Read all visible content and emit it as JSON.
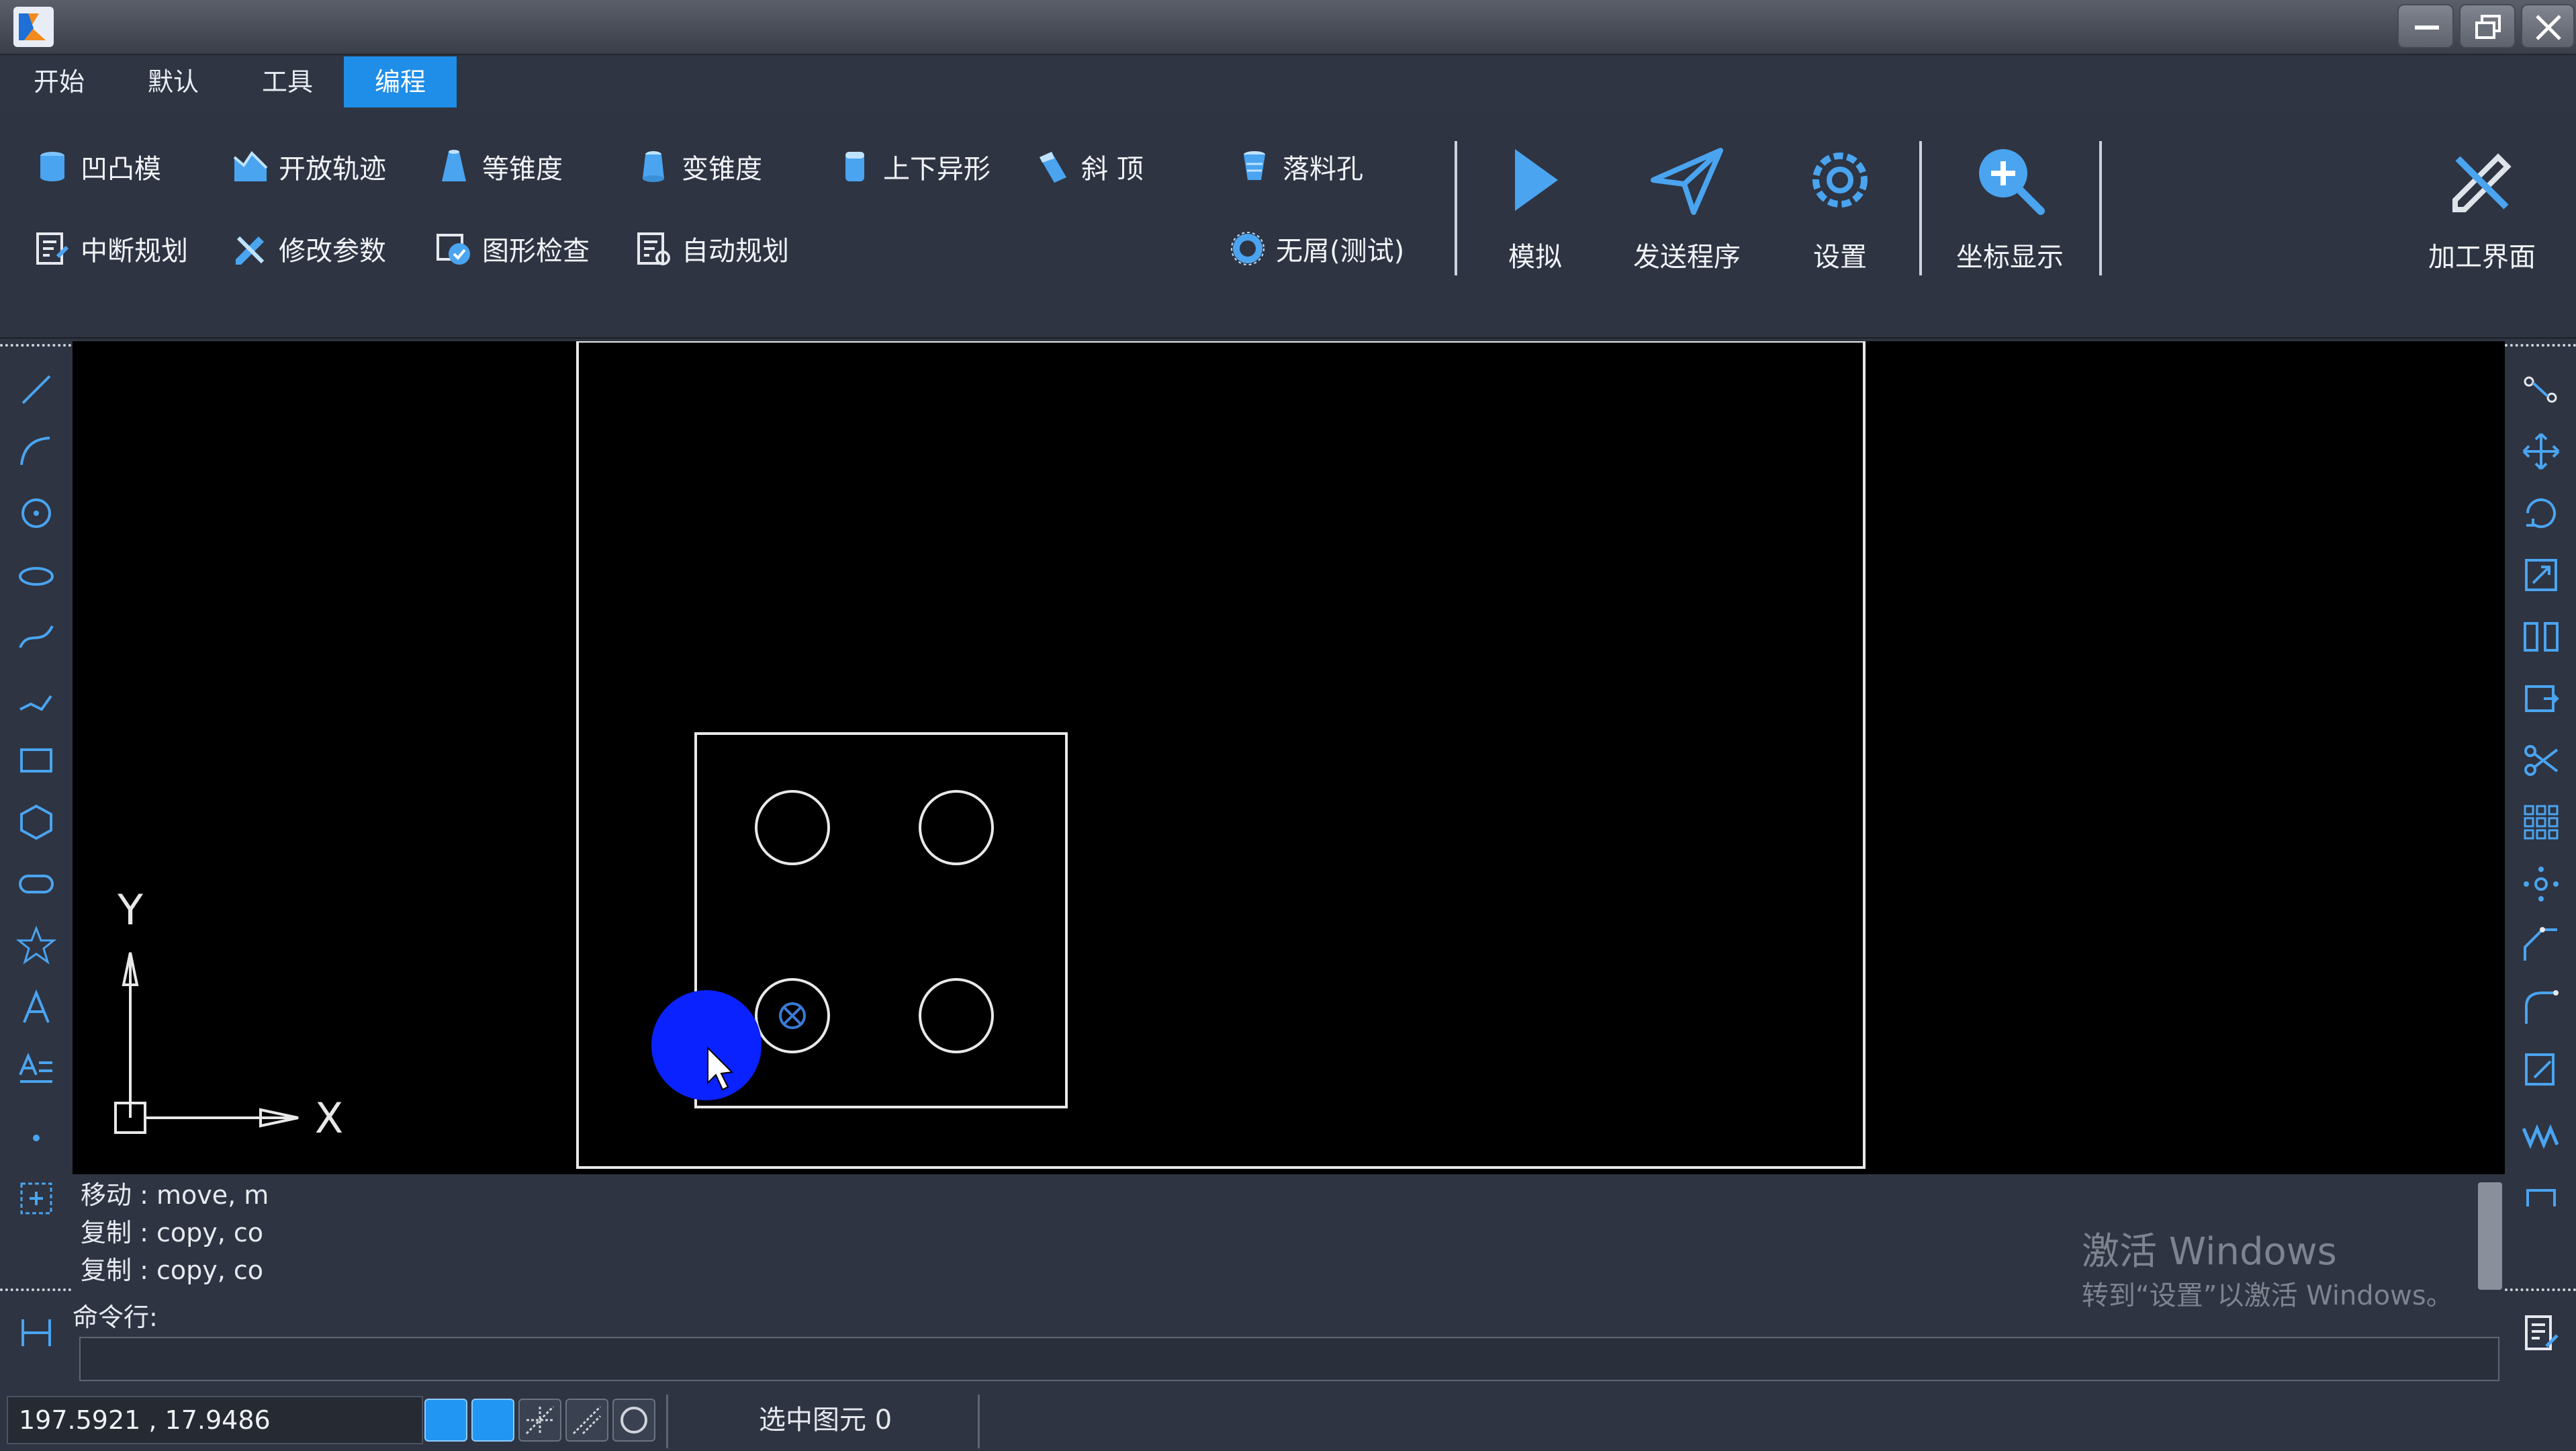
{
  "window": {
    "controls": [
      "minimize",
      "maximize",
      "close"
    ]
  },
  "menu": {
    "tabs": [
      "开始",
      "默认",
      "工具",
      "编程"
    ],
    "active": "编程"
  },
  "ribbon": {
    "row1": [
      "凹凸模",
      "开放轨迹",
      "等锥度",
      "变锥度",
      "上下异形",
      "斜 顶",
      "落料孔"
    ],
    "row2": [
      "中断规划",
      "修改参数",
      "图形检查",
      "自动规划",
      "无屑(测试)"
    ],
    "big_buttons": [
      "模拟",
      "发送程序",
      "设置",
      "坐标显示",
      "加工界面"
    ]
  },
  "canvas": {
    "axis_y": "Y",
    "axis_x": "X"
  },
  "command": {
    "history": [
      "移动 : move, m",
      "复制 : copy, co",
      "复制 : copy, co"
    ],
    "prompt": "命令行:",
    "input_value": ""
  },
  "watermark": {
    "line1": "激活 Windows",
    "line2": "转到“设置”以激活 Windows。"
  },
  "status": {
    "coordinates": "197.5921 , 17.9486",
    "selection": "选中图元 0",
    "toggles": [
      true,
      true,
      false,
      false,
      false
    ]
  },
  "colors": {
    "accent": "#1f8ee8",
    "canvas": "#000000",
    "cursor_highlight": "#0a22ff"
  }
}
